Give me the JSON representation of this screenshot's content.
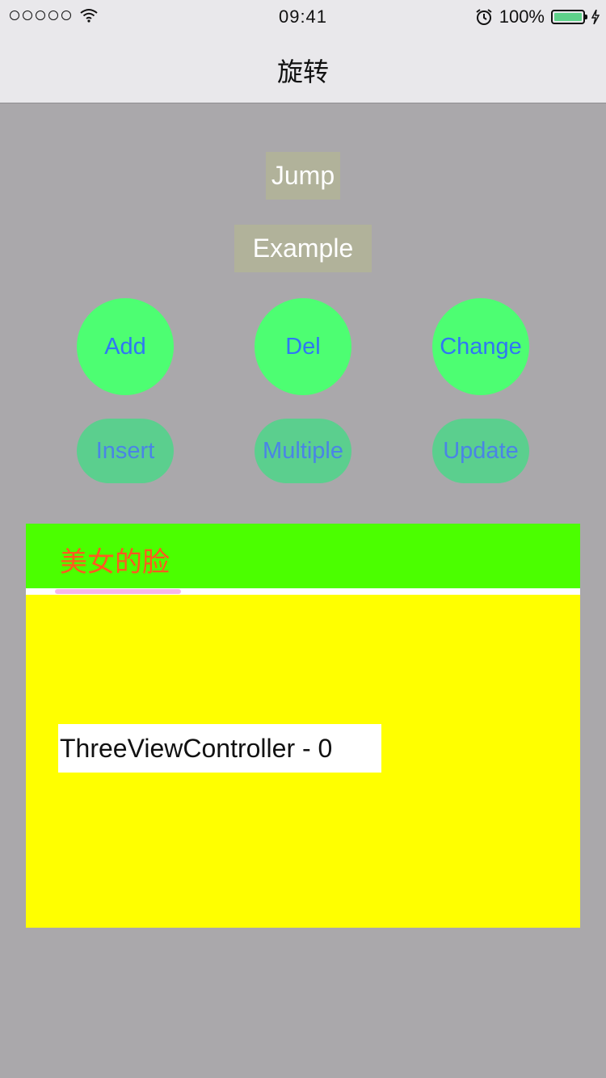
{
  "status_bar": {
    "time": "09:41",
    "battery_percent": "100%",
    "signal_dots": 5
  },
  "nav": {
    "title": "旋转"
  },
  "buttons": {
    "jump": "Jump",
    "example": "Example",
    "add": "Add",
    "del": "Del",
    "change": "Change",
    "insert": "Insert",
    "multiple": "Multiple",
    "update": "Update"
  },
  "tabs": [
    {
      "label": "美女的脸",
      "selected": true
    }
  ],
  "content": {
    "label": "ThreeViewController - 0"
  },
  "colors": {
    "background": "#aaa8ab",
    "circle_button": "#4dfe72",
    "pill_button": "#5bcf8e",
    "button_text_blue": "#2f77f4",
    "tab_bar": "#4bff00",
    "tab_text": "#ff5a1f",
    "indicator": "#f7b6ea",
    "content_bg": "#ffff00"
  }
}
